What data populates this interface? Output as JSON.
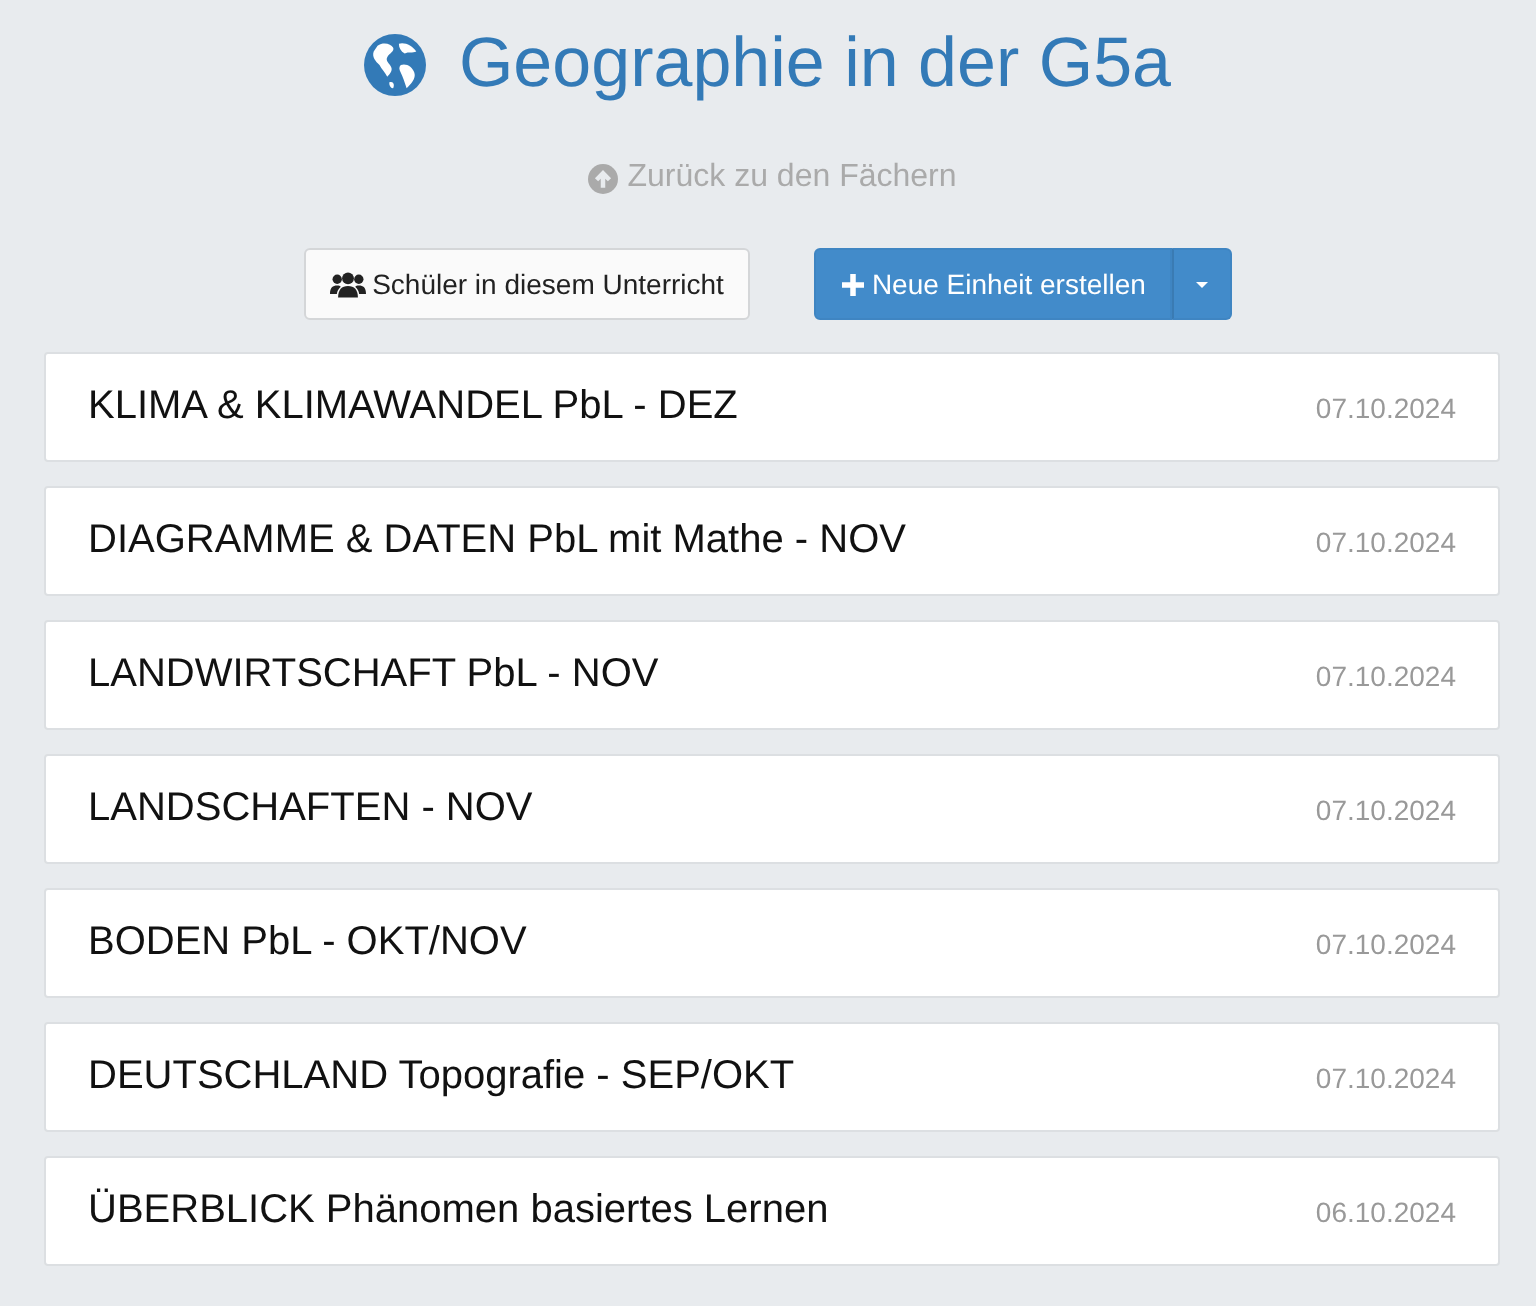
{
  "title": "Geographie in der G5a",
  "back_link": {
    "label": "Zurück zu den Fächern"
  },
  "buttons": [
    {
      "kind": "default",
      "label": "Schüler in diesem Unterricht"
    },
    {
      "kind": "primary-split",
      "label": "Neue Einheit erstellen"
    }
  ],
  "units": [
    {
      "title": "KLIMA & KLIMAWANDEL PbL - DEZ",
      "date": "07.10.2024"
    },
    {
      "title": "DIAGRAMME & DATEN PbL mit Mathe - NOV",
      "date": "07.10.2024"
    },
    {
      "title": "LANDWIRTSCHAFT PbL - NOV",
      "date": "07.10.2024"
    },
    {
      "title": "LANDSCHAFTEN - NOV",
      "date": "07.10.2024"
    },
    {
      "title": "BODEN PbL - OKT/NOV",
      "date": "07.10.2024"
    },
    {
      "title": "DEUTSCHLAND Topografie - SEP/OKT",
      "date": "07.10.2024"
    },
    {
      "title": "ÜBERBLICK Phänomen basiertes Lernen",
      "date": "06.10.2024"
    }
  ]
}
